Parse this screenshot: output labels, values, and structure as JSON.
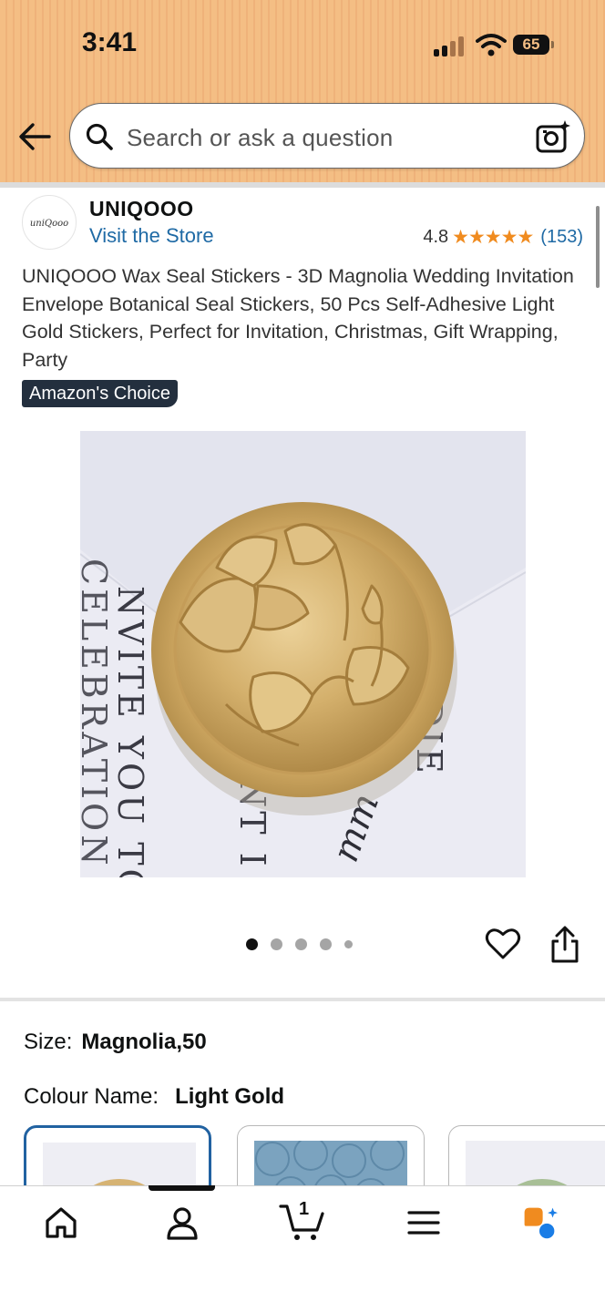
{
  "status_bar": {
    "time": "3:41",
    "battery": "65"
  },
  "search": {
    "placeholder": "Search or ask a question"
  },
  "brand": {
    "logo_text": "uniQooo",
    "name": "UNIQOOO",
    "visit_store": "Visit the Store",
    "rating": "4.8",
    "stars": "★★★★★",
    "rating_count": "(153)"
  },
  "product": {
    "title": "UNIQOOO Wax Seal Stickers - 3D Magnolia Wedding Invitation Envelope Botanical Seal Stickers, 50 Pcs Self-Adhesive Light Gold Stickers, Perfect for Invitation, Christmas, Gift Wrapping, Party",
    "badge": "Amazon's Choice",
    "image_text": {
      "line1": "NVITE YOU TO",
      "line2": "CELEBRATION O",
      "line3": "NT I",
      "line4": "DDIE",
      "script": "mm"
    }
  },
  "carousel": {
    "count": 5,
    "active_index": 0
  },
  "variations": {
    "size_label": "Size:",
    "size_value": "Magnolia,50",
    "colour_label": "Colour Name:",
    "colour_value": "Light Gold",
    "swatches": [
      {
        "name": "Light Gold",
        "color": "#d6b373",
        "selected": true
      },
      {
        "name": "Blue",
        "color": "#7ba3bf",
        "selected": false
      },
      {
        "name": "Green",
        "color": "#a8bf96",
        "selected": false
      }
    ]
  },
  "bottom_nav": {
    "items": [
      "home-icon",
      "profile-icon",
      "cart-icon",
      "menu-icon",
      "rufus-icon"
    ],
    "cart_count": "1",
    "active": "profile-icon"
  },
  "colors": {
    "header": "#f4be84",
    "link": "#1f6aa5",
    "star": "#f08b1f",
    "badge": "#232f3e",
    "selected_swatch": "#2162a1"
  }
}
